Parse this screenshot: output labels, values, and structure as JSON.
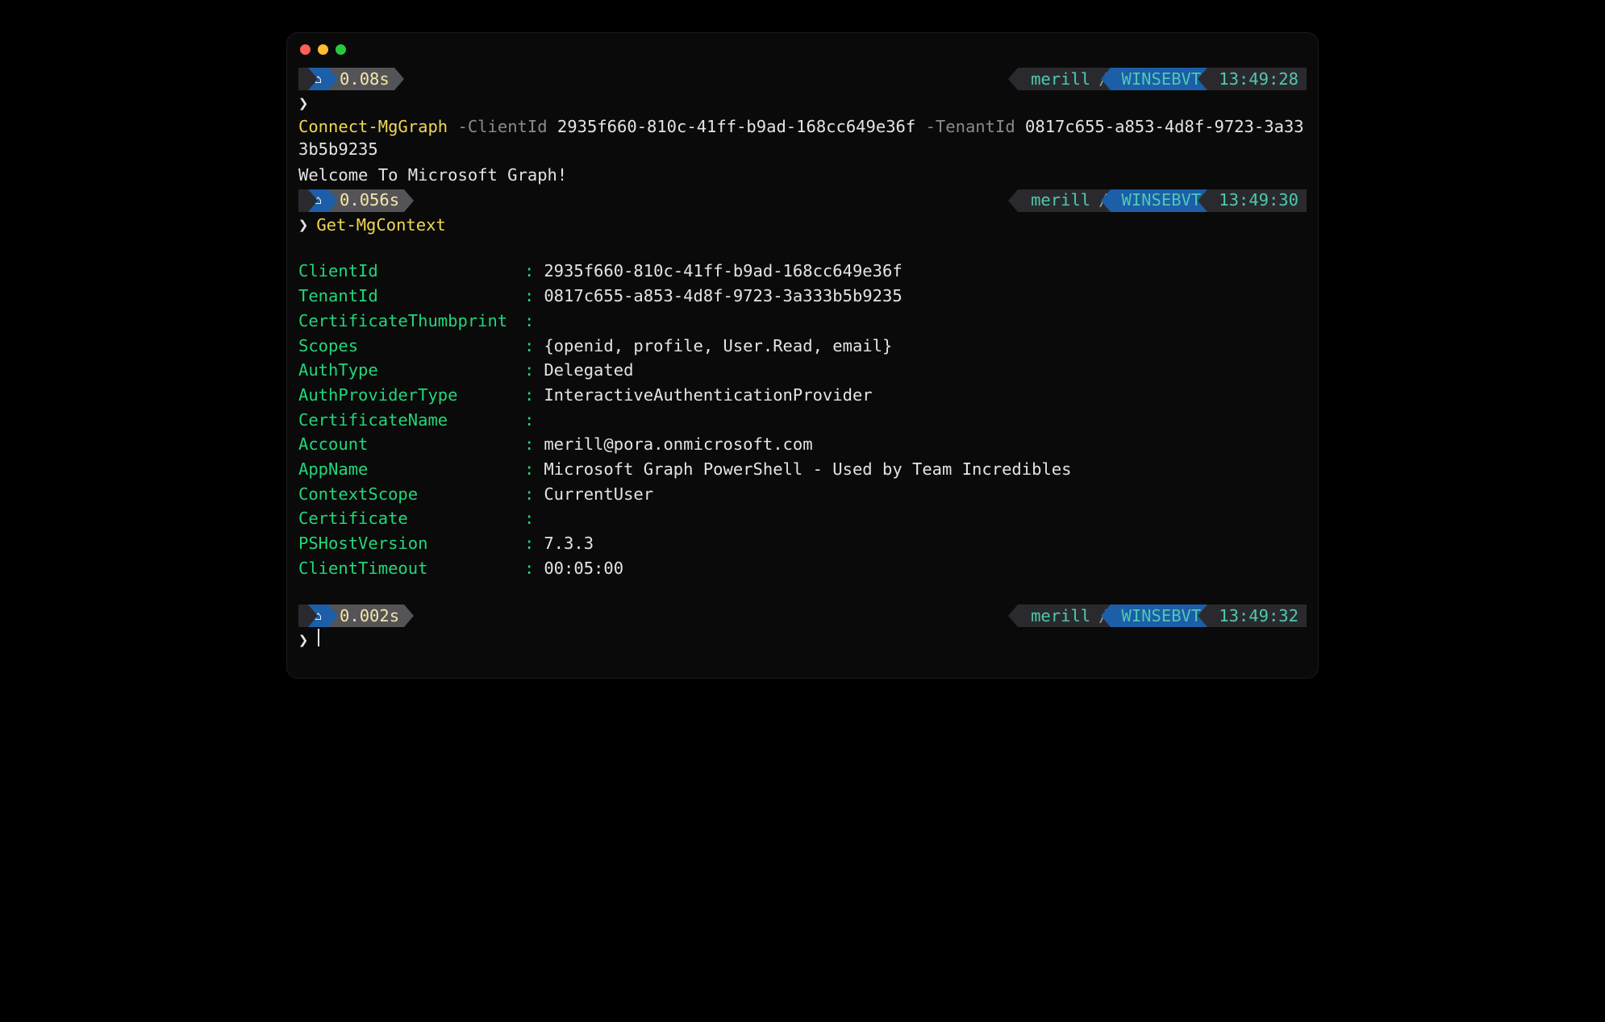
{
  "prompts": [
    {
      "duration": "0.08s",
      "user": "merill",
      "host": "WINSEBVT",
      "time": "13:49:28",
      "cmd": {
        "name": "Connect-MgGraph",
        "params": [
          {
            "flag": "-ClientId",
            "value": "2935f660-810c-41ff-b9ad-168cc649e36f"
          },
          {
            "flag": "-TenantId",
            "value": "0817c655-a853-4d8f-9723-3a333b5b9235"
          }
        ]
      },
      "output": [
        "Welcome To Microsoft Graph!"
      ]
    },
    {
      "duration": "0.056s",
      "user": "merill",
      "host": "WINSEBVT",
      "time": "13:49:30",
      "cmd": {
        "name": "Get-MgContext",
        "params": []
      },
      "output": []
    },
    {
      "duration": "0.002s",
      "user": "merill",
      "host": "WINSEBVT",
      "time": "13:49:32",
      "cmd": null,
      "output": []
    }
  ],
  "context": [
    {
      "key": "ClientId",
      "value": "2935f660-810c-41ff-b9ad-168cc649e36f"
    },
    {
      "key": "TenantId",
      "value": "0817c655-a853-4d8f-9723-3a333b5b9235"
    },
    {
      "key": "CertificateThumbprint",
      "value": ""
    },
    {
      "key": "Scopes",
      "value": "{openid, profile, User.Read, email}"
    },
    {
      "key": "AuthType",
      "value": "Delegated"
    },
    {
      "key": "AuthProviderType",
      "value": "InteractiveAuthenticationProvider"
    },
    {
      "key": "CertificateName",
      "value": ""
    },
    {
      "key": "Account",
      "value": "merill@pora.onmicrosoft.com"
    },
    {
      "key": "AppName",
      "value": "Microsoft Graph PowerShell - Used by Team Incredibles"
    },
    {
      "key": "ContextScope",
      "value": "CurrentUser"
    },
    {
      "key": "Certificate",
      "value": ""
    },
    {
      "key": "PSHostVersion",
      "value": "7.3.3"
    },
    {
      "key": "ClientTimeout",
      "value": "00:05:00"
    }
  ],
  "sep": "/"
}
